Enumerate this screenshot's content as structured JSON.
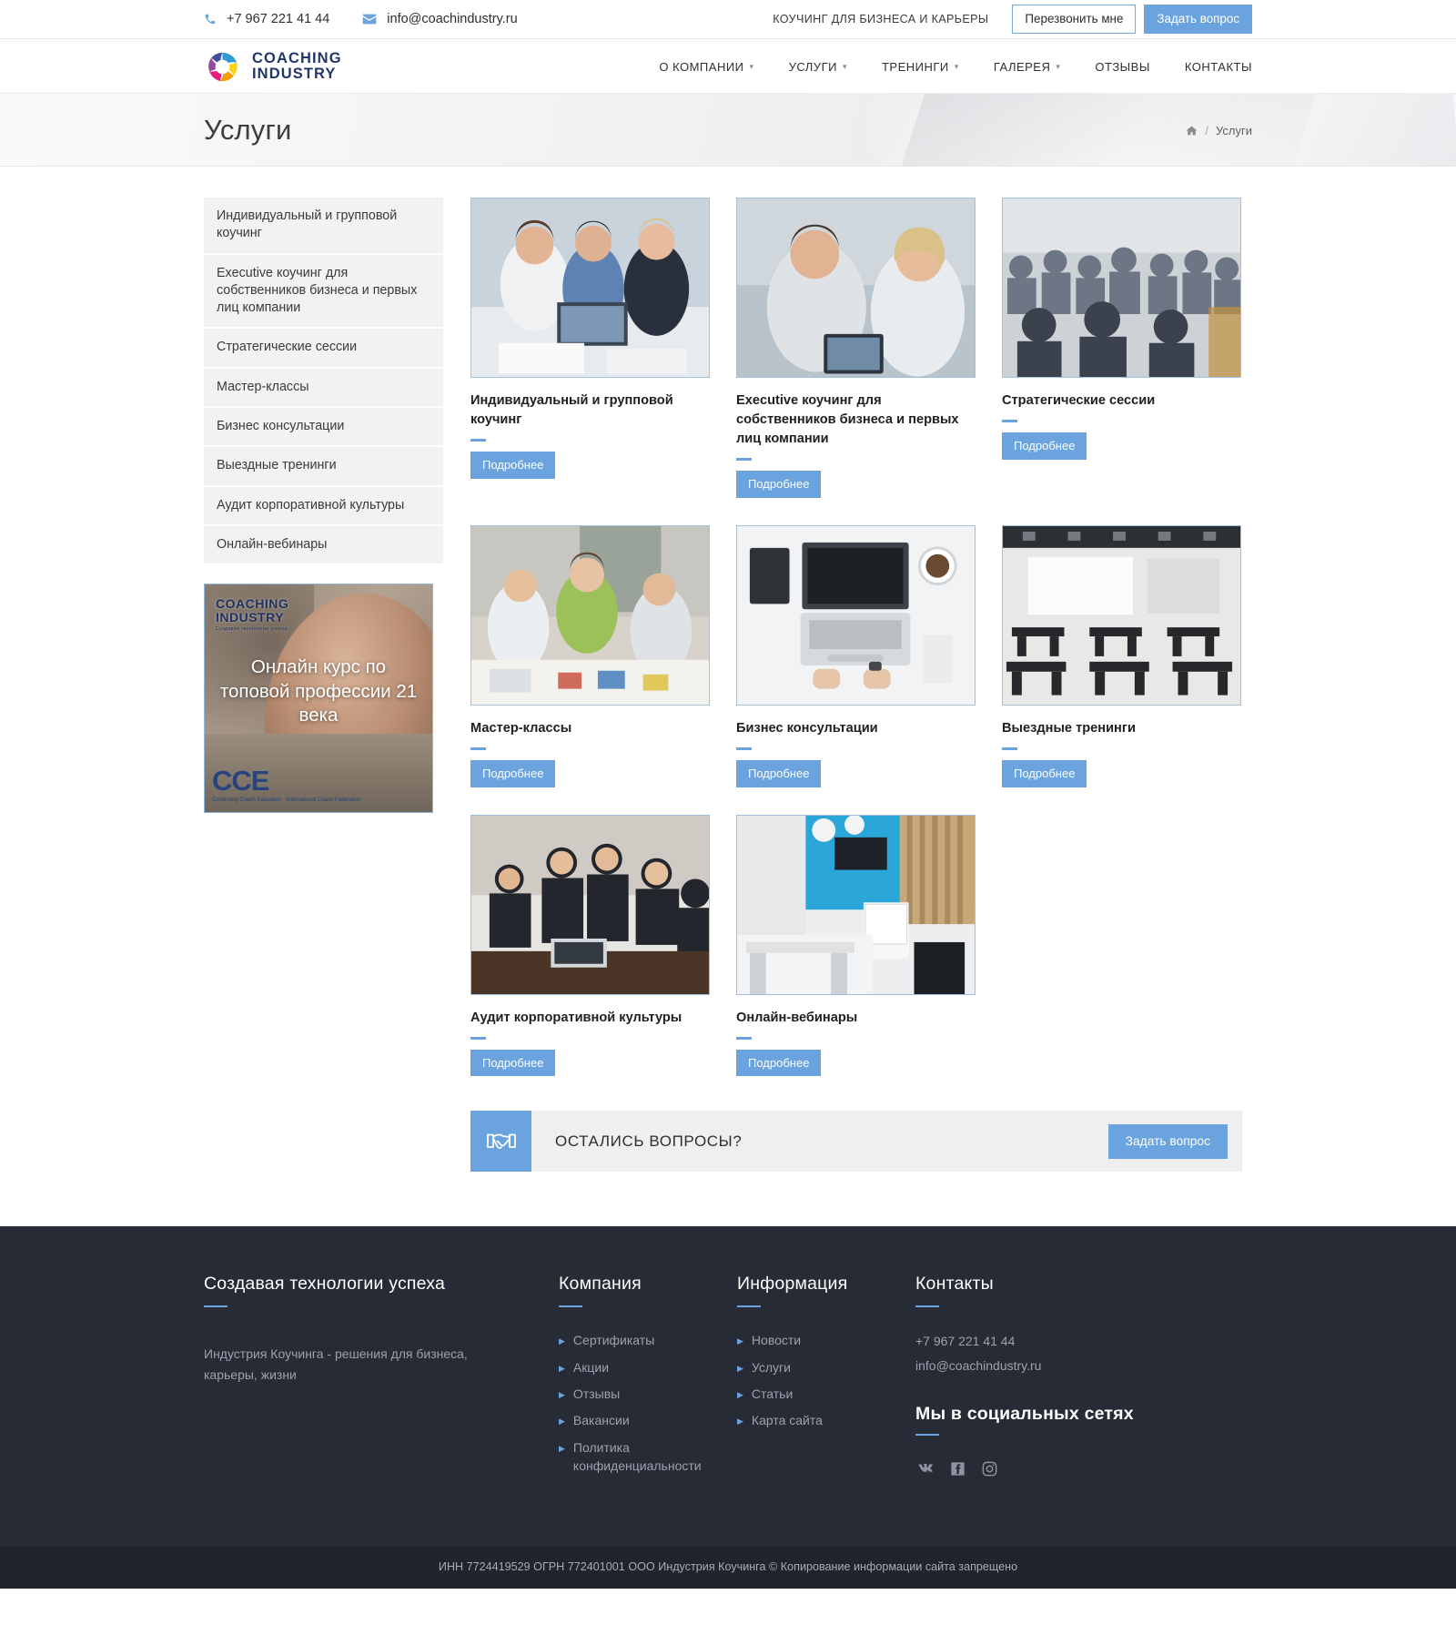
{
  "topbar": {
    "phone": "+7 967 221 41 44",
    "phone_icon": "phone-icon",
    "email": "info@coachindustry.ru",
    "email_icon": "envelope-icon",
    "slogan": "КОУЧИНГ ДЛЯ БИЗНЕСА И КАРЬЕРЫ",
    "callback_button": "Перезвонить мне",
    "ask_button": "Задать вопрос"
  },
  "header": {
    "logo": {
      "line1": "COACHING",
      "line2": "INDUSTRY",
      "icon": "coaching-industry-logo"
    },
    "nav": [
      {
        "label": "О КОМПАНИИ",
        "has_dropdown": true
      },
      {
        "label": "УСЛУГИ",
        "has_dropdown": true
      },
      {
        "label": "ТРЕНИНГИ",
        "has_dropdown": true
      },
      {
        "label": "ГАЛЕРЕЯ",
        "has_dropdown": true
      },
      {
        "label": "ОТЗЫВЫ",
        "has_dropdown": false
      },
      {
        "label": "КОНТАКТЫ",
        "has_dropdown": false
      }
    ]
  },
  "hero": {
    "title": "Услуги",
    "breadcrumb": {
      "home_icon": "home-icon",
      "separator": "/",
      "current": "Услуги"
    }
  },
  "sidebar": {
    "items": [
      {
        "label": "Индивидуальный и групповой коучинг"
      },
      {
        "label": "Executive коучинг для собственников бизнеса и первых лиц компании"
      },
      {
        "label": "Стратегические сессии"
      },
      {
        "label": "Мастер-классы"
      },
      {
        "label": "Бизнес консультации"
      },
      {
        "label": "Выездные тренинги"
      },
      {
        "label": "Аудит корпоративной культуры"
      },
      {
        "label": "Онлайн-вебинары"
      }
    ],
    "promo": {
      "logo_line1": "COACHING",
      "logo_line2": "INDUSTRY",
      "logo_tagline": "Создавая технологии успеха",
      "title": "Онлайн курс по топовой профессии 21 века",
      "badge": "CCE",
      "badge_sub": "Continuing Coach Education · International Coach Federation"
    }
  },
  "services": {
    "more_label": "Подробнее",
    "cards": [
      {
        "title": "Индивидуальный и групповой коучинг",
        "image": "photo-three-colleagues-at-laptop"
      },
      {
        "title": "Executive коучинг для собственников бизнеса и первых лиц компании",
        "image": "photo-man-and-woman-with-tablet"
      },
      {
        "title": "Стратегические сессии",
        "image": "photo-conference-audience"
      },
      {
        "title": "Мастер-классы",
        "image": "photo-workshop-group-table"
      },
      {
        "title": "Бизнес консультации",
        "image": "photo-laptop-desk-top-view"
      },
      {
        "title": "Выездные тренинги",
        "image": "photo-empty-training-room"
      },
      {
        "title": "Аудит корпоративной культуры",
        "image": "photo-business-team-meeting"
      },
      {
        "title": "Онлайн-вебинары",
        "image": "photo-modern-blue-office"
      }
    ]
  },
  "cta": {
    "icon": "handshake-icon",
    "text": "ОСТАЛИСЬ ВОПРОСЫ?",
    "button": "Задать вопрос"
  },
  "footer": {
    "about": {
      "heading": "Создавая технологии успеха",
      "description": "Индустрия Коучинга - решения для бизнеса, карьеры, жизни"
    },
    "company": {
      "heading": "Компания",
      "links": [
        "Сертификаты",
        "Акции",
        "Отзывы",
        "Вакансии",
        "Политика конфиденциальности"
      ]
    },
    "information": {
      "heading": "Информация",
      "links": [
        "Новости",
        "Услуги",
        "Статьи",
        "Карта сайта"
      ]
    },
    "contacts": {
      "heading": "Контакты",
      "phone": "+7 967 221 41 44",
      "email": "info@coachindustry.ru",
      "social_heading": "Мы в социальных сетях",
      "socials": [
        "vk-icon",
        "facebook-icon",
        "instagram-icon"
      ]
    },
    "copyright": "ИНН 7724419529 ОГРН 772401001 ООО Индустрия Коучинга © Копирование информации сайта запрещено"
  },
  "colors": {
    "accent": "#6aa3dd",
    "footer_bg": "#272b35",
    "copyright_bg": "#21242c"
  }
}
